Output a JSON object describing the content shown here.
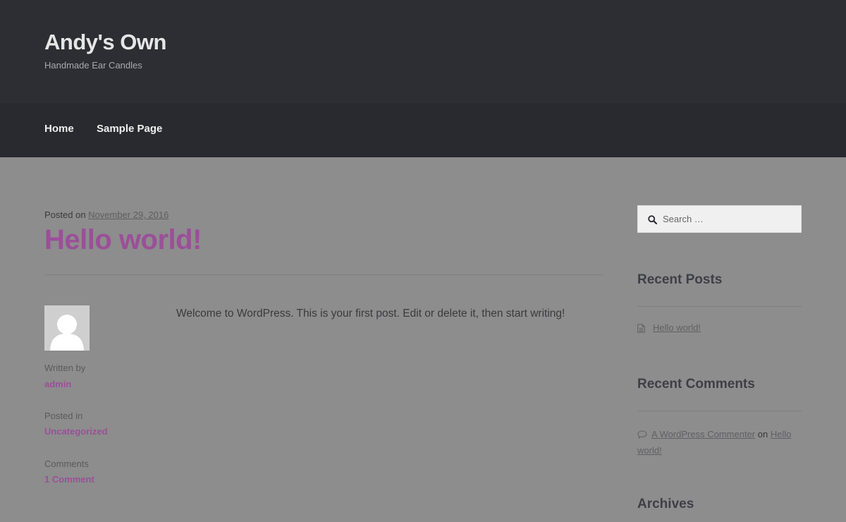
{
  "site": {
    "title": "Andy's Own",
    "tagline": "Handmade Ear Candles"
  },
  "nav": {
    "items": [
      {
        "label": "Home"
      },
      {
        "label": "Sample Page"
      }
    ]
  },
  "post": {
    "posted_on_label": "Posted on",
    "date": "November 29, 2016",
    "title": "Hello world!",
    "content": "Welcome to WordPress. This is your first post. Edit or delete it, then start writing!",
    "meta": {
      "written_by_label": "Written by",
      "author": "admin",
      "posted_in_label": "Posted in",
      "category": "Uncategorized",
      "comments_label": "Comments",
      "comments_count": "1 Comment"
    }
  },
  "sidebar": {
    "search": {
      "placeholder": "Search …",
      "icon": "search-icon"
    },
    "recent_posts": {
      "title": "Recent Posts",
      "items": [
        {
          "label": "Hello world!",
          "icon": "document-icon"
        }
      ]
    },
    "recent_comments": {
      "title": "Recent Comments",
      "items": [
        {
          "author": "A WordPress Commenter",
          "on": "on",
          "post": "Hello world!",
          "icon": "comment-icon"
        }
      ]
    },
    "archives": {
      "title": "Archives"
    }
  },
  "colors": {
    "header_bg": "#2d2e33",
    "nav_bg": "#292a30",
    "page_bg": "#8d8d8d",
    "accent": "#9b4f98"
  }
}
